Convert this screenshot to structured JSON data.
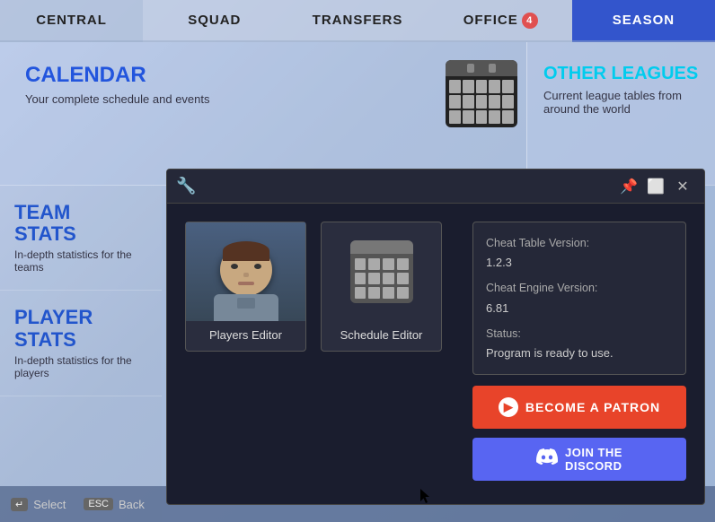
{
  "nav": {
    "items": [
      {
        "id": "central",
        "label": "CENTRAL",
        "active": false
      },
      {
        "id": "squad",
        "label": "SQUAD",
        "active": false
      },
      {
        "id": "transfers",
        "label": "TRANSFERS",
        "active": false
      },
      {
        "id": "office",
        "label": "OFFICE",
        "badge": "4",
        "active": false
      },
      {
        "id": "season",
        "label": "SEASON",
        "active": true
      }
    ]
  },
  "calendar_card": {
    "title": "CALENDAR",
    "description": "Your complete schedule and events"
  },
  "other_leagues_card": {
    "title": "OTHER LEAGUES",
    "description": "Current league tables from around the world"
  },
  "team_stats": {
    "title": "TEAM\nSTATS",
    "description": "In-depth statistics for the teams"
  },
  "player_stats": {
    "title": "PLAYER STATS",
    "description": "In-depth statistics for the players"
  },
  "bottom_bar": {
    "select_label": "Select",
    "back_label": "Back",
    "select_key": "↵",
    "back_key": "ESC"
  },
  "overlay": {
    "titlebar": {
      "icon": "🔧",
      "pin_icon": "📌",
      "restore_icon": "⬜",
      "close_icon": "✕"
    },
    "editors": [
      {
        "id": "players",
        "label": "Players Editor"
      },
      {
        "id": "schedule",
        "label": "Schedule Editor"
      }
    ],
    "info": {
      "cheat_table_version_label": "Cheat Table Version:",
      "cheat_table_version": "1.2.3",
      "cheat_engine_version_label": "Cheat Engine Version:",
      "cheat_engine_version": "6.81",
      "status_label": "Status:",
      "status_value": "Program is ready to use."
    },
    "patron_btn_label": "BECOME A PATRON",
    "discord_line1": "JOIN THE",
    "discord_line2": "DISCORD"
  }
}
